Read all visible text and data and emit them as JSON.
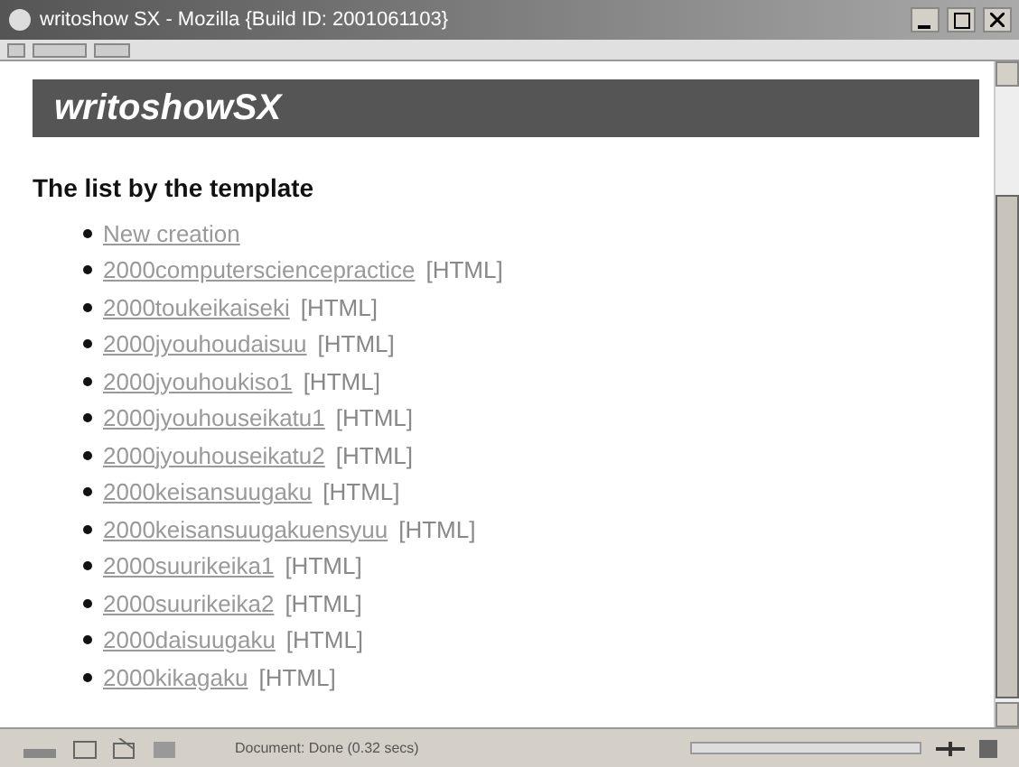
{
  "window": {
    "title": "writoshow SX - Mozilla {Build ID: 2001061103}"
  },
  "page": {
    "banner": "writoshowSX",
    "heading": "The list by the template",
    "items": [
      {
        "label": "New creation"
      },
      {
        "label": "2000computersciencepractice",
        "format_link": "[HTML]"
      },
      {
        "label": "2000toukeikaiseki",
        "format_link": "[HTML]"
      },
      {
        "label": "2000jyouhoudaisuu",
        "format_link": "[HTML]"
      },
      {
        "label": "2000jyouhoukiso1",
        "format_link": "[HTML]"
      },
      {
        "label": "2000jyouhouseikatu1",
        "format_link": "[HTML]"
      },
      {
        "label": "2000jyouhouseikatu2",
        "format_link": "[HTML]"
      },
      {
        "label": "2000keisansuugaku",
        "format_link": "[HTML]"
      },
      {
        "label": "2000keisansuugakuensyuu",
        "format_link": "[HTML]"
      },
      {
        "label": "2000suurikeika1",
        "format_link": "[HTML]"
      },
      {
        "label": "2000suurikeika2",
        "format_link": "[HTML]"
      },
      {
        "label": "2000daisuugaku",
        "format_link": "[HTML]"
      },
      {
        "label": "2000kikagaku",
        "format_link": "[HTML]"
      }
    ]
  },
  "status_bar": {
    "text": "Document: Done (0.32 secs)"
  }
}
